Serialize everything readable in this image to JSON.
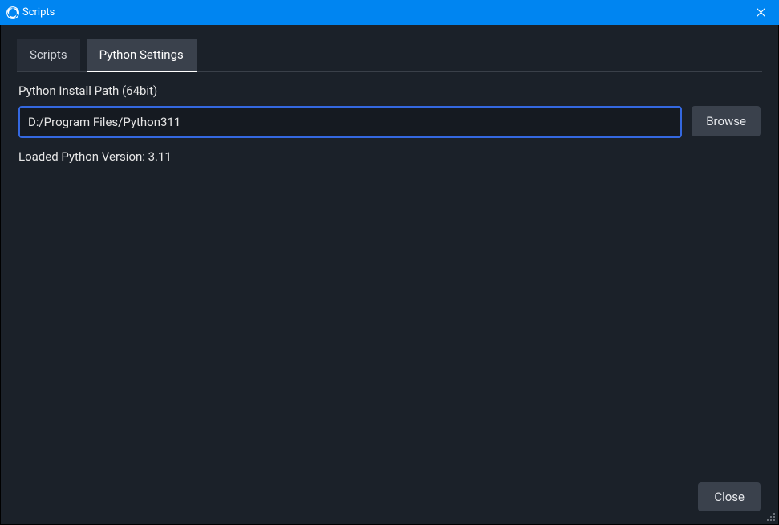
{
  "window": {
    "title": "Scripts"
  },
  "tabs": {
    "scripts": "Scripts",
    "python_settings": "Python Settings",
    "active": "python_settings"
  },
  "python": {
    "path_label": "Python Install Path (64bit)",
    "path_value": "D:/Program Files/Python311",
    "browse_label": "Browse",
    "loaded_status": "Loaded Python Version: 3.11"
  },
  "footer": {
    "close_label": "Close"
  }
}
